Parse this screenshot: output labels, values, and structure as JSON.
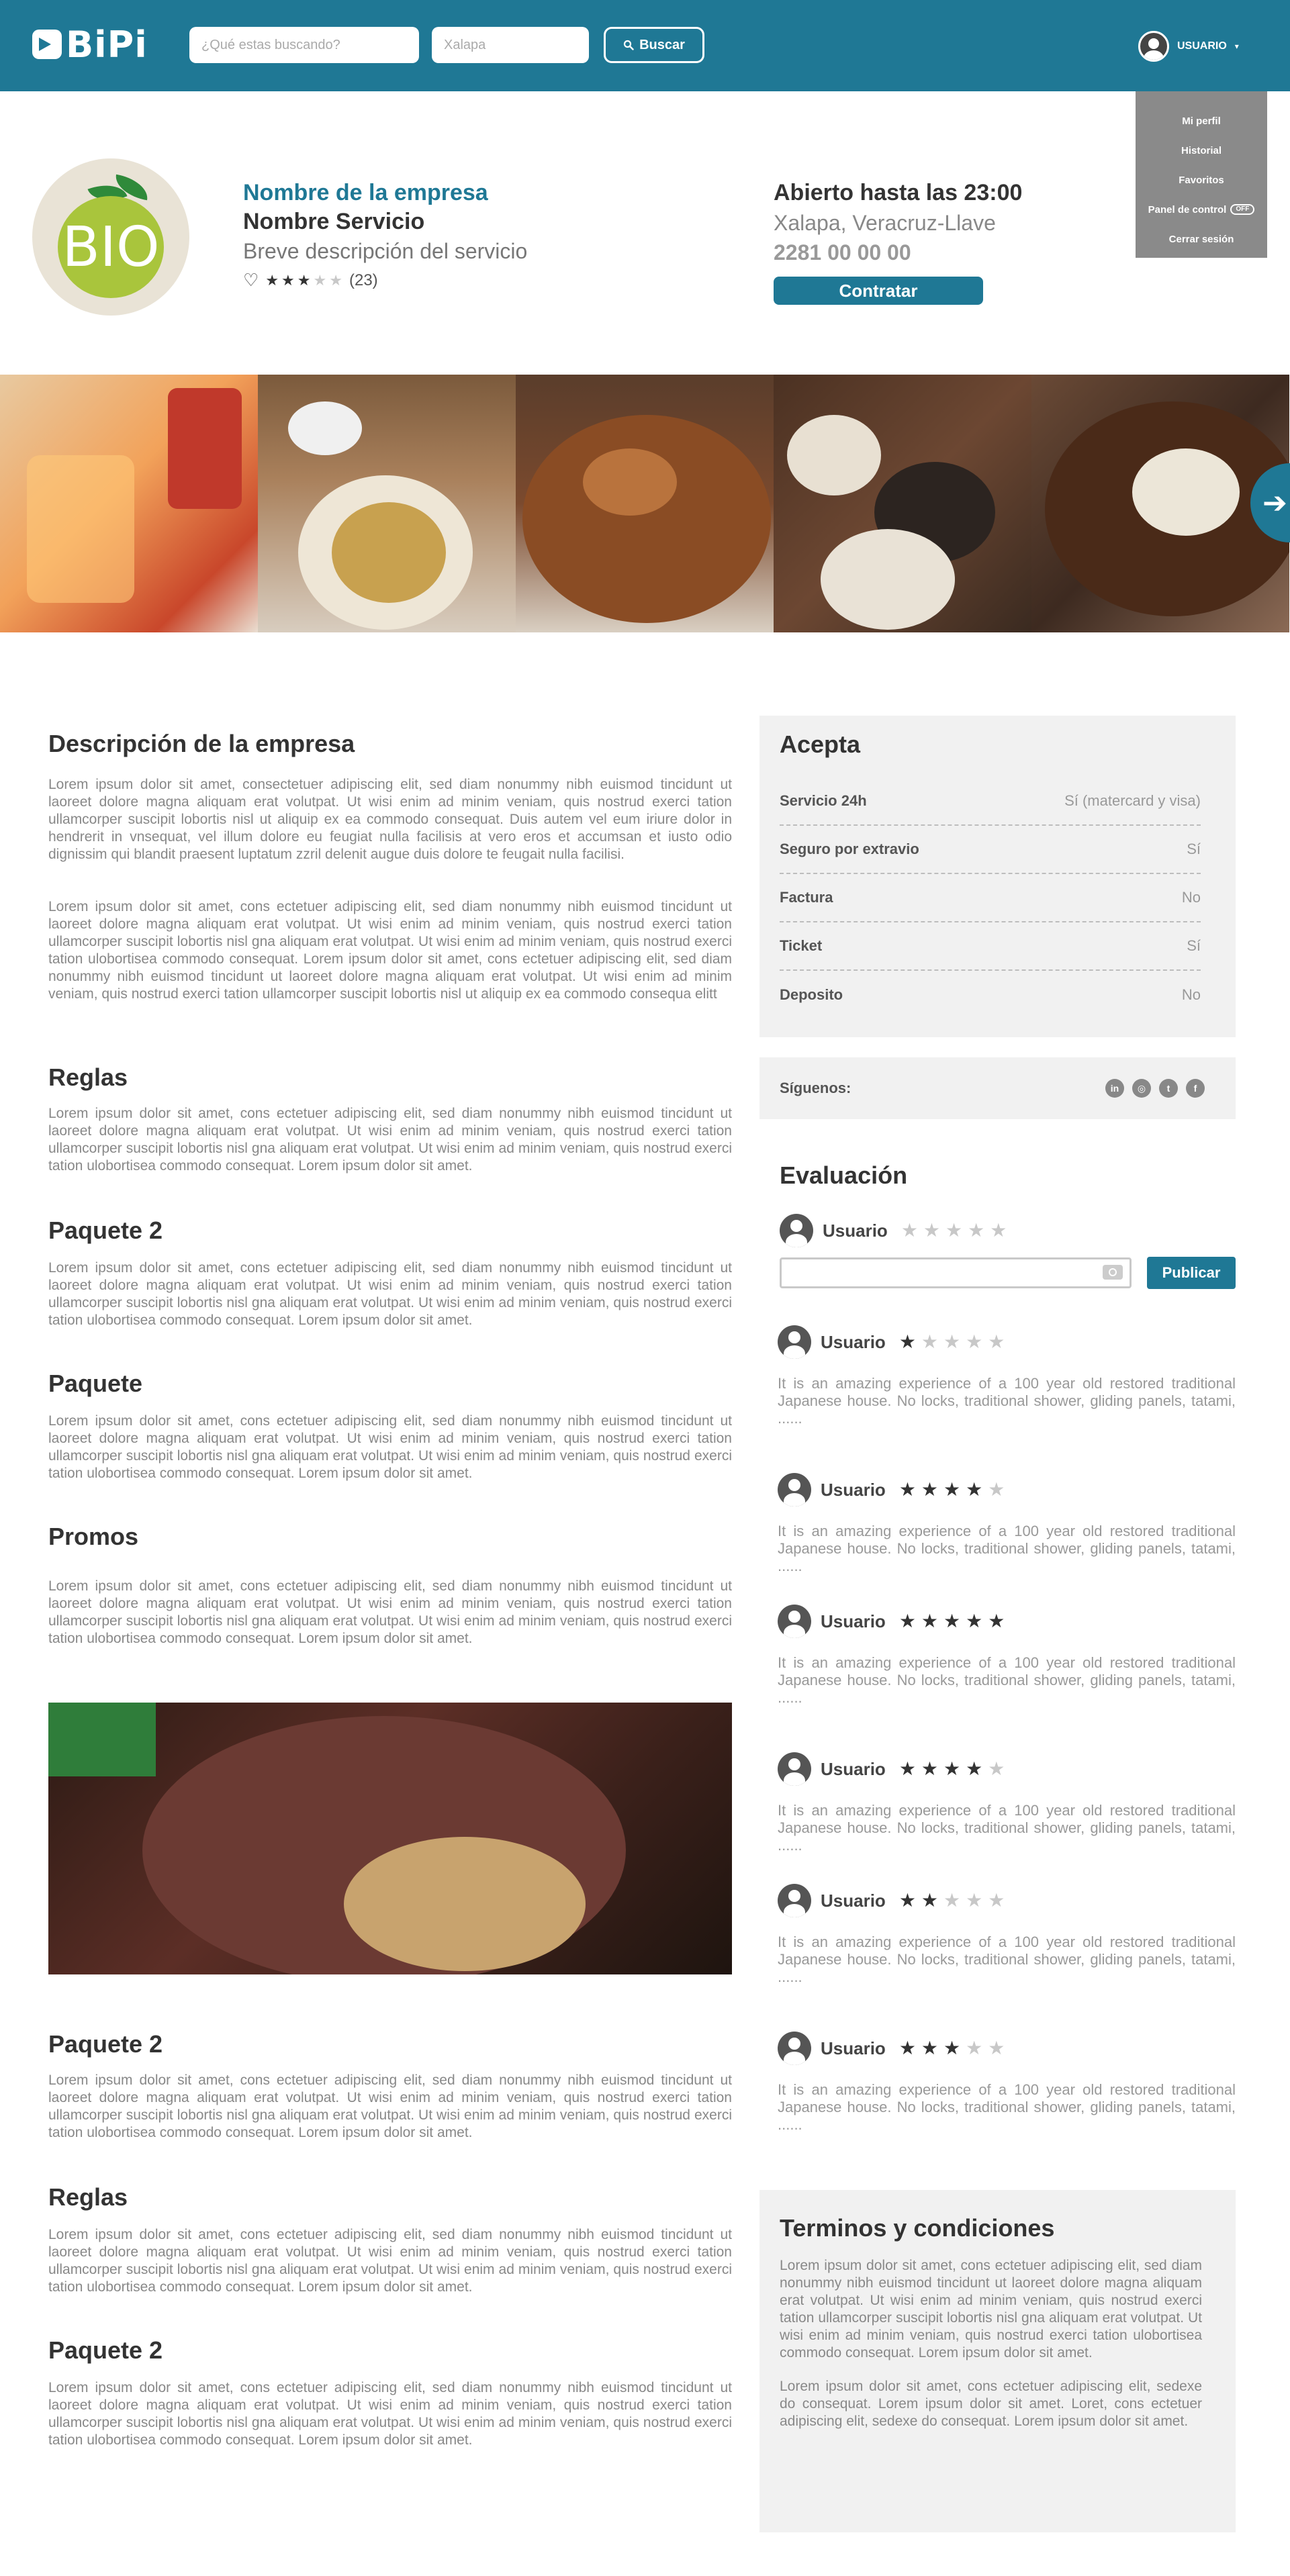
{
  "header": {
    "logo_text": "BiPi",
    "search_placeholder": "¿Qué estas buscando?",
    "location_placeholder": "Xalapa",
    "search_button": "Buscar",
    "user_label": "USUARIO"
  },
  "user_menu": {
    "items": [
      "Mi perfil",
      "Historial",
      "Favoritos",
      "Panel de control",
      "Cerrar sesión"
    ],
    "panel_badge": "OFF"
  },
  "company": {
    "logo_text": "BIO",
    "name": "Nombre de la empresa",
    "service": "Nombre Servicio",
    "description": "Breve descripción del servicio",
    "rating": 3,
    "rating_max": 5,
    "review_count": "(23)",
    "hours": "Abierto hasta las 23:00",
    "address": "Xalapa, Veracruz-Llave",
    "phone": "2281 00 00 00",
    "hire_button": "Contratar"
  },
  "main": {
    "sections": [
      {
        "title": "Descripción de la empresa",
        "paragraphs": [
          "Lorem ipsum dolor sit amet, consectetuer adipiscing elit, sed diam nonummy nibh euismod tincidunt ut laoreet dolore magna aliquam erat volutpat. Ut wisi enim ad minim veniam, quis nostrud exerci tation ullamcorper suscipit lobortis nisl ut aliquip ex ea commodo consequat. Duis autem vel eum iriure dolor in hendrerit in vnsequat, vel illum dolore eu feugiat nulla facilisis at vero eros et accumsan et iusto odio dignissim qui blandit praesent luptatum zzril delenit augue duis dolore te feugait nulla facilisi.",
          "Lorem ipsum dolor sit amet, cons ectetuer adipiscing elit, sed diam nonummy nibh euismod tincidunt ut laoreet dolore magna aliquam erat volutpat. Ut wisi enim ad minim veniam, quis nostrud exerci tation ullamcorper suscipit lobortis nisl gna aliquam erat volutpat. Ut wisi enim ad minim veniam, quis nostrud exerci tation ulobortisea commodo consequat. Lorem ipsum dolor sit amet, cons ectetuer adipiscing elit, sed diam nonummy nibh euismod tincidunt ut laoreet dolore magna aliquam erat volutpat. Ut wisi enim ad minim veniam, quis nostrud exerci tation ullamcorper suscipit lobortis nisl ut aliquip ex ea commodo consequa elitt"
        ]
      },
      {
        "title": "Reglas",
        "paragraphs": [
          "Lorem ipsum dolor sit amet, cons ectetuer adipiscing elit, sed diam nonummy nibh euismod tincidunt ut laoreet dolore magna aliquam erat volutpat. Ut wisi enim ad minim veniam, quis nostrud exerci tation ullamcorper suscipit lobortis nisl gna aliquam erat volutpat. Ut wisi enim ad minim veniam, quis nostrud exerci tation ulobortisea commodo consequat. Lorem ipsum dolor sit amet."
        ]
      },
      {
        "title": "Paquete 2",
        "paragraphs": [
          "Lorem ipsum dolor sit amet, cons ectetuer adipiscing elit, sed diam nonummy nibh euismod tincidunt ut laoreet dolore magna aliquam erat volutpat. Ut wisi enim ad minim veniam, quis nostrud exerci tation ullamcorper suscipit lobortis nisl gna aliquam erat volutpat. Ut wisi enim ad minim veniam, quis nostrud exerci tation ulobortisea commodo consequat. Lorem ipsum dolor sit amet."
        ]
      },
      {
        "title": "Paquete",
        "paragraphs": [
          "Lorem ipsum dolor sit amet, cons ectetuer adipiscing elit, sed diam nonummy nibh euismod tincidunt ut laoreet dolore magna aliquam erat volutpat. Ut wisi enim ad minim veniam, quis nostrud exerci tation ullamcorper suscipit lobortis nisl gna aliquam erat volutpat. Ut wisi enim ad minim veniam, quis nostrud exerci tation ulobortisea commodo consequat. Lorem ipsum dolor sit amet."
        ]
      },
      {
        "title": "Promos",
        "paragraphs": [
          "Lorem ipsum dolor sit amet, cons ectetuer adipiscing elit, sed diam nonummy nibh euismod tincidunt ut laoreet dolore magna aliquam erat volutpat. Ut wisi enim ad minim veniam, quis nostrud exerci tation ullamcorper suscipit lobortis nisl gna aliquam erat volutpat. Ut wisi enim ad minim veniam, quis nostrud exerci tation ulobortisea commodo consequat. Lorem ipsum dolor sit amet."
        ]
      },
      {
        "title": "Paquete 2",
        "paragraphs": [
          "Lorem ipsum dolor sit amet, cons ectetuer adipiscing elit, sed diam nonummy nibh euismod tincidunt ut laoreet dolore magna aliquam erat volutpat. Ut wisi enim ad minim veniam, quis nostrud exerci tation ullamcorper suscipit lobortis nisl gna aliquam erat volutpat. Ut wisi enim ad minim veniam, quis nostrud exerci tation ulobortisea commodo consequat. Lorem ipsum dolor sit amet."
        ]
      },
      {
        "title": "Reglas",
        "paragraphs": [
          "Lorem ipsum dolor sit amet, cons ectetuer adipiscing elit, sed diam nonummy nibh euismod tincidunt ut laoreet dolore magna aliquam erat volutpat. Ut wisi enim ad minim veniam, quis nostrud exerci tation ullamcorper suscipit lobortis nisl gna aliquam erat volutpat. Ut wisi enim ad minim veniam, quis nostrud exerci tation ulobortisea commodo consequat. Lorem ipsum dolor sit amet."
        ]
      },
      {
        "title": "Paquete 2",
        "paragraphs": [
          "Lorem ipsum dolor sit amet, cons ectetuer adipiscing elit, sed diam nonummy nibh euismod tincidunt ut laoreet dolore magna aliquam erat volutpat. Ut wisi enim ad minim veniam, quis nostrud exerci tation ullamcorper suscipit lobortis nisl gna aliquam erat volutpat. Ut wisi enim ad minim veniam, quis nostrud exerci tation ulobortisea commodo consequat. Lorem ipsum dolor sit amet."
        ]
      }
    ]
  },
  "accepts": {
    "title": "Acepta",
    "rows": [
      {
        "label": "Servicio 24h",
        "value": "Sí (matercard y visa)"
      },
      {
        "label": "Seguro por extravio",
        "value": "Sí"
      },
      {
        "label": "Factura",
        "value": "No"
      },
      {
        "label": "Ticket",
        "value": "Sí"
      },
      {
        "label": "Deposito",
        "value": "No"
      }
    ]
  },
  "social": {
    "label": "Síguenos:",
    "icons": [
      "linkedin-icon",
      "instagram-icon",
      "twitter-icon",
      "facebook-icon"
    ]
  },
  "evaluation": {
    "title": "Evaluación",
    "current_user": "Usuario",
    "publish_button": "Publicar",
    "reviews": [
      {
        "user": "Usuario",
        "stars": 1,
        "text": "It is an amazing experience of a 100 year old restored traditional Japanese house. No locks, traditional shower, gliding panels, tatami, ......"
      },
      {
        "user": "Usuario",
        "stars": 4,
        "text": "It is an amazing experience of a 100 year old restored traditional Japanese house. No locks, traditional shower, gliding panels, tatami, ......"
      },
      {
        "user": "Usuario",
        "stars": 5,
        "text": "It is an amazing experience of a 100 year old restored traditional Japanese house. No locks, traditional shower, gliding panels, tatami, ......"
      },
      {
        "user": "Usuario",
        "stars": 4,
        "text": "It is an amazing experience of a 100 year old restored traditional Japanese house. No locks, traditional shower, gliding panels, tatami, ......"
      },
      {
        "user": "Usuario",
        "stars": 2,
        "text": "It is an amazing experience of a 100 year old restored traditional Japanese house. No locks, traditional shower, gliding panels, tatami, ......"
      },
      {
        "user": "Usuario",
        "stars": 3,
        "text": "It is an amazing experience of a 100 year old restored traditional Japanese house. No locks, traditional shower, gliding panels, tatami, ......"
      }
    ]
  },
  "terms": {
    "title": "Terminos y condiciones",
    "paragraphs": [
      "Lorem ipsum dolor sit amet, cons ectetuer adipiscing elit, sed diam nonummy nibh euismod tincidunt ut laoreet dolore magna aliquam erat volutpat. Ut wisi enim ad minim veniam, quis nostrud exerci tation ullamcorper suscipit lobortis nisl gna aliquam erat volutpat. Ut wisi enim ad minim veniam, quis nostrud exerci tation ulobortisea commodo consequat. Lorem ipsum dolor sit amet.",
      "Lorem ipsum dolor sit amet, cons ectetuer adipiscing elit, sedexe do consequat. Lorem ipsum dolor sit amet. Loret, cons ectetuer adipiscing elit, sedexe do consequat. Lorem ipsum dolor sit amet."
    ]
  },
  "colors": {
    "brand": "#1f7895",
    "menu_bg": "#8a8a8a",
    "panel_bg": "#f1f1f1"
  }
}
